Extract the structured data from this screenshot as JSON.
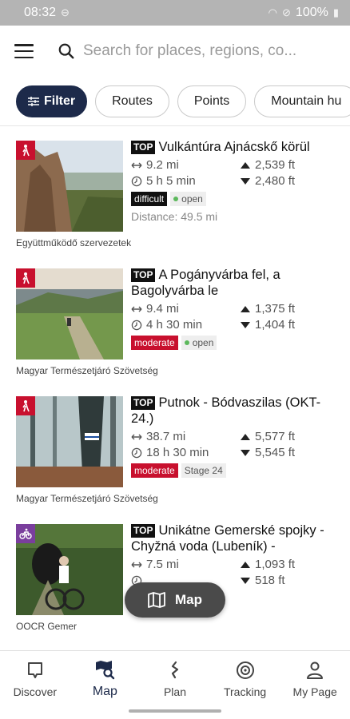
{
  "status_bar": {
    "time": "08:32",
    "battery": "100%"
  },
  "search": {
    "placeholder": "Search for places, regions, co..."
  },
  "chips": {
    "filter": "Filter",
    "routes": "Routes",
    "points": "Points",
    "mountain_huts": "Mountain hu"
  },
  "tours": [
    {
      "activity_icon": "hiking-icon",
      "activity_color": "#c8102e",
      "top_tag": "TOP",
      "title": "Vulkántúra Ajnácskő körül",
      "length": "9.2 mi",
      "duration": "5 h 5 min",
      "ascent": "2,539 ft",
      "descent": "2,480 ft",
      "difficulty": "difficult",
      "status": "open",
      "distance": "Distance: 49.5 mi",
      "source": "Együttműködő szervezetek"
    },
    {
      "activity_icon": "hiking-icon",
      "activity_color": "#c8102e",
      "top_tag": "TOP",
      "title": "A Pogányvárba fel, a Bagolyvárba le",
      "length": "9.4 mi",
      "duration": "4 h 30 min",
      "ascent": "1,375 ft",
      "descent": "1,404 ft",
      "difficulty": "moderate",
      "status": "open",
      "source": "Magyar Természetjáró Szövetség"
    },
    {
      "activity_icon": "hiking-icon",
      "activity_color": "#c8102e",
      "top_tag": "TOP",
      "title": "Putnok - Bódvaszilas (OKT-24.)",
      "length": "38.7 mi",
      "duration": "18 h 30 min",
      "ascent": "5,577 ft",
      "descent": "5,545 ft",
      "difficulty": "moderate",
      "stage": "Stage 24",
      "source": "Magyar Természetjáró Szövetség"
    },
    {
      "activity_icon": "mountain-bike-icon",
      "activity_color": "#7a3e9d",
      "top_tag": "TOP",
      "title": "Unikátne Gemerské spojky - Chyžná voda (Lubeník) -",
      "length": "7.5 mi",
      "ascent": "1,093 ft",
      "descent": "518 ft",
      "source": "OOCR Gemer"
    }
  ],
  "map_button": {
    "label": "Map"
  },
  "nav": {
    "discover": "Discover",
    "map": "Map",
    "plan": "Plan",
    "tracking": "Tracking",
    "my_page": "My Page"
  },
  "colors": {
    "primary": "#1d2a4a",
    "moderate": "#c8102e",
    "open_dot": "#5cb85c"
  }
}
